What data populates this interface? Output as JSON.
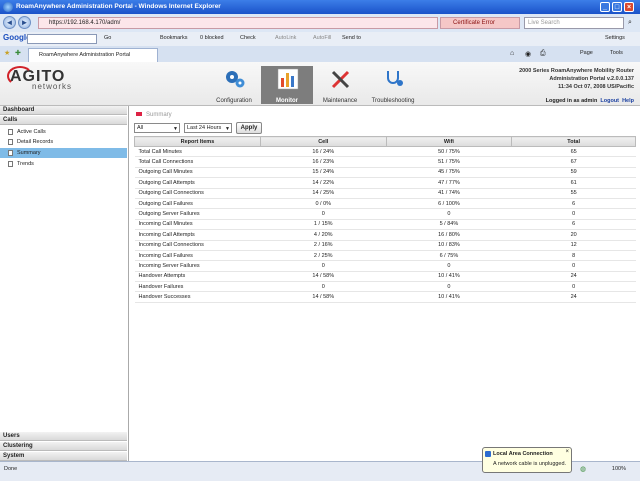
{
  "window": {
    "title": "RoamAnywhere Administration Portal - Windows Internet Explorer"
  },
  "browser": {
    "url": "https://192.168.4.170/adm/",
    "cert_error": "Certificate Error",
    "live_search_placeholder": "Live Search",
    "tab_title": "RoamAnywhere Administration Portal",
    "page_menu": "Page",
    "tools_menu": "Tools"
  },
  "google_toolbar": {
    "logo": "Google",
    "go_label": "Go",
    "bookmarks": "Bookmarks",
    "blocked": "0 blocked",
    "check": "Check",
    "autolink": "AutoLink",
    "autofill": "AutoFill",
    "sendto": "Send to",
    "settings": "Settings"
  },
  "app": {
    "logo_main": "AGITO",
    "logo_sub": "networks",
    "nav": [
      {
        "label": "Configuration"
      },
      {
        "label": "Monitor"
      },
      {
        "label": "Maintenance"
      },
      {
        "label": "Troubleshooting"
      }
    ],
    "product_line1": "2000 Series RoamAnywhere Mobility Router",
    "product_line2": "Administration Portal v.2.0.0.137",
    "product_line3": "11:34 Oct 07, 2008 US/Pacific",
    "logged_in": "Logged in as admin",
    "logout": "Logout",
    "help": "Help"
  },
  "sidebar": {
    "dashboard": "Dashboard",
    "calls": "Calls",
    "items": [
      {
        "label": "Active Calls"
      },
      {
        "label": "Detail Records"
      },
      {
        "label": "Summary"
      },
      {
        "label": "Trends"
      }
    ],
    "users": "Users",
    "clustering": "Clustering",
    "system": "System"
  },
  "content": {
    "breadcrumb": "Summary",
    "filter_value": "All",
    "period_value": "Last 24 Hours",
    "apply": "Apply",
    "headers": [
      "Report Items",
      "Cell",
      "Wifi",
      "Total"
    ],
    "rows": [
      [
        "Total Call Minutes",
        "16 / 24%",
        "50 / 75%",
        "65"
      ],
      [
        "Total Call Connections",
        "16 / 23%",
        "51 / 75%",
        "67"
      ],
      [
        "Outgoing Call Minutes",
        "15 / 24%",
        "45 / 75%",
        "59"
      ],
      [
        "Outgoing Call Attempts",
        "14 / 22%",
        "47 / 77%",
        "61"
      ],
      [
        "Outgoing Call Connections",
        "14 / 25%",
        "41 / 74%",
        "55"
      ],
      [
        "Outgoing Call Failures",
        "0 / 0%",
        "6 / 100%",
        "6"
      ],
      [
        "Outgoing Server Failures",
        "0",
        "0",
        "0"
      ],
      [
        "Incoming Call Minutes",
        "1 / 15%",
        "5 / 84%",
        "6"
      ],
      [
        "Incoming Call Attempts",
        "4 / 20%",
        "16 / 80%",
        "20"
      ],
      [
        "Incoming Call Connections",
        "2 / 16%",
        "10 / 83%",
        "12"
      ],
      [
        "Incoming Call Failures",
        "2 / 25%",
        "6 / 75%",
        "8"
      ],
      [
        "Incoming Server Failures",
        "0",
        "0",
        "0"
      ],
      [
        "Handover Attempts",
        "14 / 58%",
        "10 / 41%",
        "24"
      ],
      [
        "Handover Failures",
        "0",
        "0",
        "0"
      ],
      [
        "Handover Successes",
        "14 / 58%",
        "10 / 41%",
        "24"
      ]
    ]
  },
  "status": {
    "text": "Done",
    "zoom": "100%",
    "balloon_title": "Local Area Connection",
    "balloon_msg": "A network cable is unplugged."
  },
  "colors": {
    "accent": "#7fbbe7",
    "nav_active": "#7d7d7d",
    "brand_red": "#d1232a"
  }
}
